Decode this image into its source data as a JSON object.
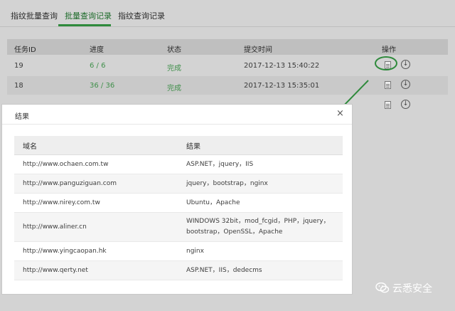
{
  "tabs": [
    {
      "label": "指纹批量查询",
      "active": false
    },
    {
      "label": "批量查询记录",
      "active": true
    },
    {
      "label": "指纹查询记录",
      "active": false
    }
  ],
  "task_table": {
    "headers": [
      "任务ID",
      "进度",
      "状态",
      "提交时间",
      "操作"
    ],
    "rows": [
      {
        "id": "19",
        "progress": "6 / 6",
        "status": "完成",
        "time": "2017-12-13 15:40:22"
      },
      {
        "id": "18",
        "progress": "36 / 36",
        "status": "完成",
        "time": "2017-12-13 15:35:01"
      }
    ]
  },
  "modal": {
    "title": "结果",
    "close": "×",
    "headers": [
      "域名",
      "结果"
    ],
    "rows": [
      {
        "domain": "http://www.ochaen.com.tw",
        "result": [
          "ASP.NET，jquery，IIS"
        ]
      },
      {
        "domain": "http://www.panguziguan.com",
        "result": [
          "jquery，bootstrap，nginx"
        ]
      },
      {
        "domain": "http://www.nirey.com.tw",
        "result": [
          "Ubuntu，Apache"
        ]
      },
      {
        "domain": "http://www.aliner.cn",
        "result": [
          "WINDOWS 32bit，mod_fcgid，PHP，jquery，",
          "bootstrap，OpenSSL，Apache"
        ]
      },
      {
        "domain": "http://www.yingcaopan.hk",
        "result": [
          "nginx"
        ]
      },
      {
        "domain": "http://www.qerty.net",
        "result": [
          "ASP.NET，IIS，dedecms"
        ]
      }
    ]
  },
  "watermark": {
    "text": "云悉安全",
    "icon": "wechat-icon"
  },
  "colors": {
    "accent_green": "#2f8a3c",
    "status_green": "#3f8f4a"
  }
}
